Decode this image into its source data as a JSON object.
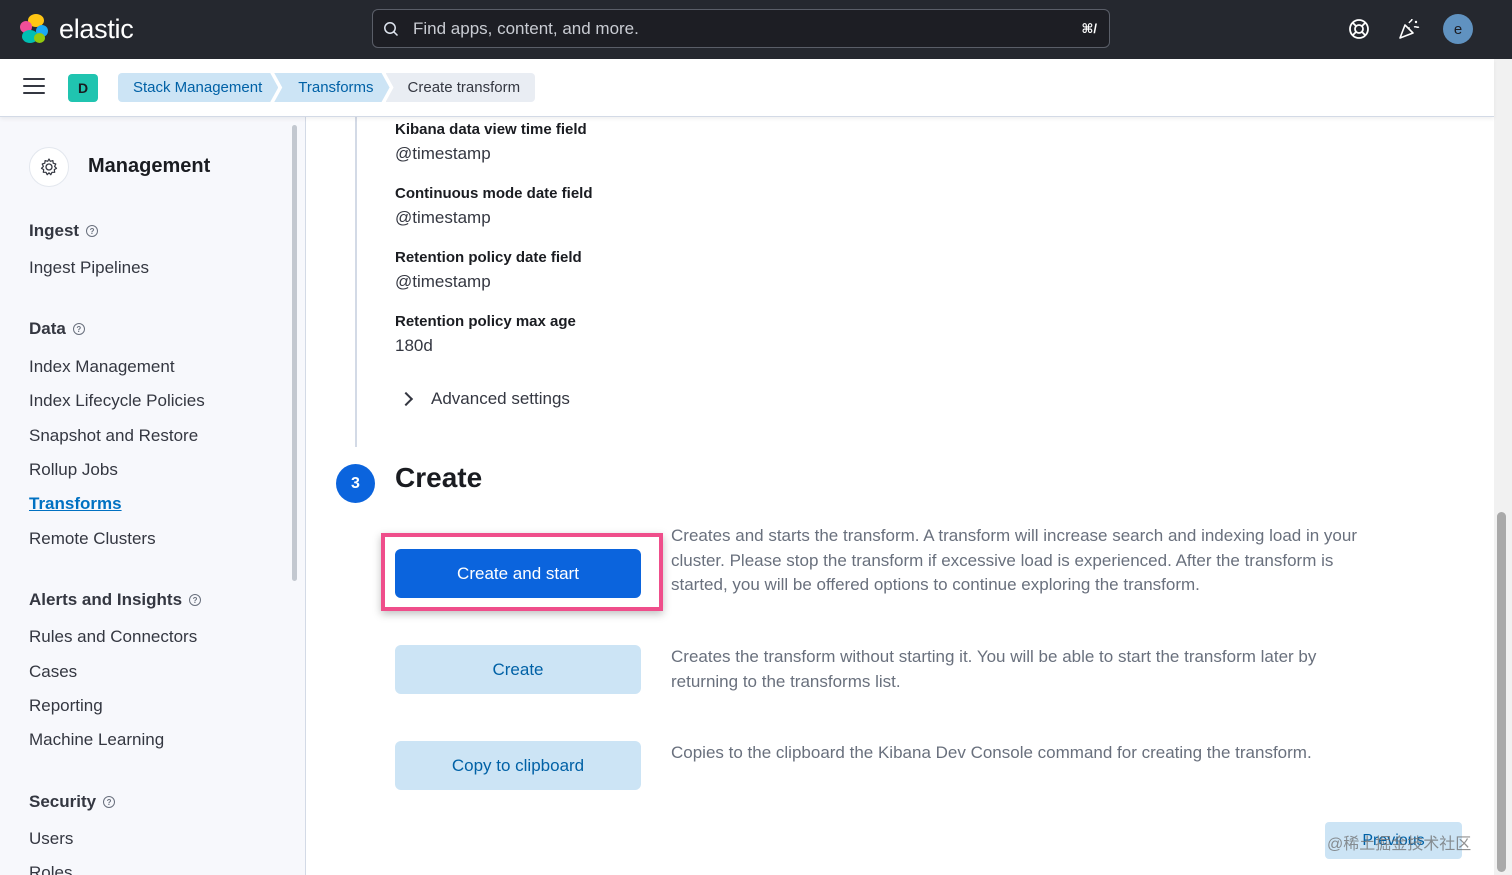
{
  "header": {
    "brand": "elastic",
    "search_placeholder": "Find apps, content, and more.",
    "search_shortcut": "⌘/",
    "avatar_initial": "e",
    "icons": [
      "help-icon",
      "newsfeed-icon"
    ]
  },
  "subheader": {
    "space_initial": "D",
    "breadcrumbs": [
      "Stack Management",
      "Transforms",
      "Create transform"
    ]
  },
  "sidebar": {
    "title": "Management",
    "sections": [
      {
        "label": "Ingest",
        "items": [
          "Ingest Pipelines"
        ]
      },
      {
        "label": "Data",
        "items": [
          "Index Management",
          "Index Lifecycle Policies",
          "Snapshot and Restore",
          "Rollup Jobs",
          "Transforms",
          "Remote Clusters"
        ]
      },
      {
        "label": "Alerts and Insights",
        "items": [
          "Rules and Connectors",
          "Cases",
          "Reporting",
          "Machine Learning"
        ]
      },
      {
        "label": "Security",
        "items": [
          "Users",
          "Roles"
        ]
      }
    ],
    "active_item": "Transforms"
  },
  "details": [
    {
      "title": "Kibana data view time field",
      "value": "@timestamp"
    },
    {
      "title": "Continuous mode date field",
      "value": "@timestamp"
    },
    {
      "title": "Retention policy date field",
      "value": "@timestamp"
    },
    {
      "title": "Retention policy max age",
      "value": "180d"
    }
  ],
  "advanced_settings_label": "Advanced settings",
  "step": {
    "number": "3",
    "title": "Create"
  },
  "actions": [
    {
      "label": "Create and start",
      "description": "Creates and starts the transform. A transform will increase search and indexing load in your cluster. Please stop the transform if excessive load is experienced. After the transform is started, you will be offered options to continue exploring the transform."
    },
    {
      "label": "Create",
      "description": "Creates the transform without starting it. You will be able to start the transform later by returning to the transforms list."
    },
    {
      "label": "Copy to clipboard",
      "description": "Copies to the clipboard the Kibana Dev Console command for creating the transform."
    }
  ],
  "footer": {
    "previous_label": "Previous",
    "watermark": "@稀土掘金技术社区"
  },
  "colors": {
    "primary": "#0b64dd",
    "highlight": "#ef4e8b",
    "header_bg": "#25282f"
  }
}
